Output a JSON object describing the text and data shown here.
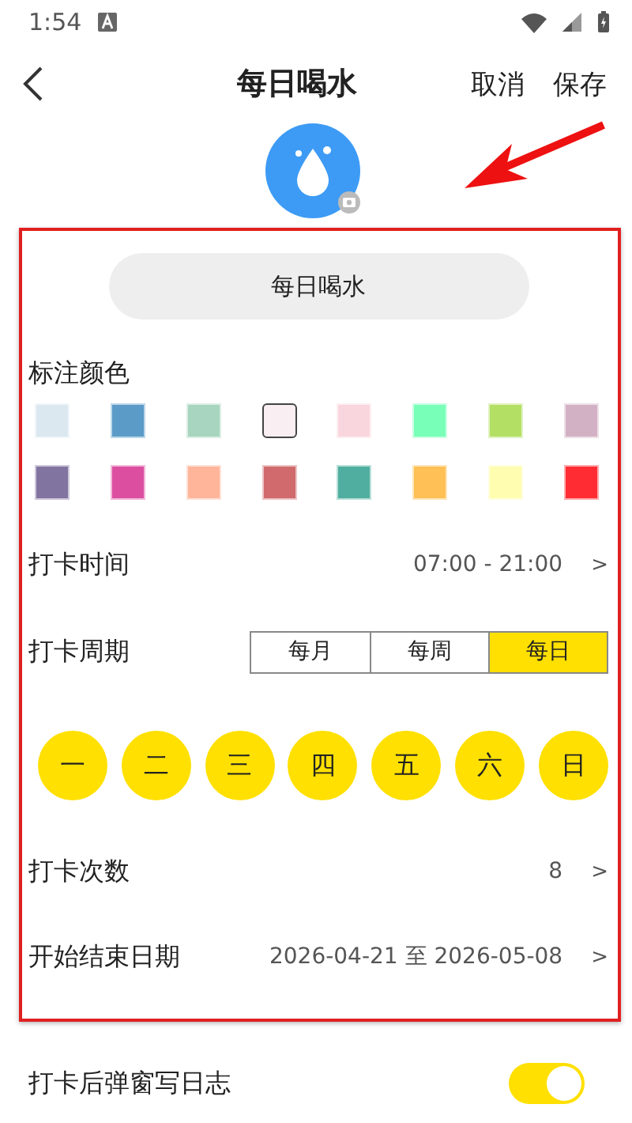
{
  "status_bar": {
    "time": "1:54"
  },
  "header": {
    "title": "每日喝水",
    "actions": [
      "取消",
      "保存"
    ]
  },
  "name_field": {
    "value": "每日喝水"
  },
  "color_picker": {
    "label": "标注颜色",
    "swatches": [
      {
        "color": "#dce8f0",
        "selected": false
      },
      {
        "color": "#5b9bc8",
        "selected": false
      },
      {
        "color": "#a8d5bf",
        "selected": false
      },
      {
        "color": "#f9eef1",
        "selected": true
      },
      {
        "color": "#f9d6de",
        "selected": false
      },
      {
        "color": "#78ffb8",
        "selected": false
      },
      {
        "color": "#b3df64",
        "selected": false
      },
      {
        "color": "#d3b1c4",
        "selected": false
      },
      {
        "color": "#8274a0",
        "selected": false
      },
      {
        "color": "#dc4fa0",
        "selected": false
      },
      {
        "color": "#ffb59a",
        "selected": false
      },
      {
        "color": "#d06a6c",
        "selected": false
      },
      {
        "color": "#4fae9f",
        "selected": false
      },
      {
        "color": "#ffc055",
        "selected": false
      },
      {
        "color": "#fffdb0",
        "selected": false
      },
      {
        "color": "#ff2d33",
        "selected": false
      }
    ]
  },
  "checkin_time": {
    "label": "打卡时间",
    "value": "07:00 - 21:00",
    "chevron": ">"
  },
  "period": {
    "label": "打卡周期",
    "options": [
      {
        "label": "每月",
        "selected": false
      },
      {
        "label": "每周",
        "selected": false
      },
      {
        "label": "每日",
        "selected": true
      }
    ]
  },
  "weekdays": [
    {
      "label": "一",
      "selected": true
    },
    {
      "label": "二",
      "selected": true
    },
    {
      "label": "三",
      "selected": true
    },
    {
      "label": "四",
      "selected": true
    },
    {
      "label": "五",
      "selected": true
    },
    {
      "label": "六",
      "selected": true
    },
    {
      "label": "日",
      "selected": true
    }
  ],
  "checkin_count": {
    "label": "打卡次数",
    "value": "8",
    "chevron": ">"
  },
  "date_range": {
    "label": "开始结束日期",
    "value": "2026-04-21 至 2026-05-08",
    "chevron": ">"
  },
  "journal_toggle": {
    "label": "打卡后弹窗写日志",
    "on": true
  }
}
